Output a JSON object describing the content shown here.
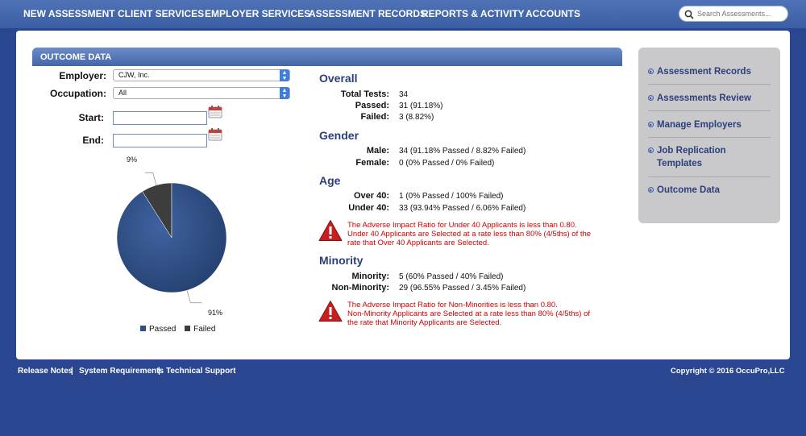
{
  "nav": {
    "items": [
      "NEW ASSESSMENT",
      "CLIENT SERVICES",
      "EMPLOYER SERVICES",
      "ASSESSMENT RECORDS",
      "REPORTS & ACTIVITY",
      "ACCOUNTS"
    ],
    "search_placeholder": "Search Assessments..."
  },
  "section": {
    "title": "OUTCOME DATA"
  },
  "filters": {
    "employer_label": "Employer:",
    "employer_value": "CJW, Inc.",
    "occupation_label": "Occupation:",
    "occupation_value": "All",
    "start_label": "Start:",
    "start_value": "",
    "end_label": "End:",
    "end_value": ""
  },
  "chart_data": {
    "type": "pie",
    "slices": [
      {
        "name": "Passed",
        "value": 91,
        "label": "91%",
        "color": "#2e4e84"
      },
      {
        "name": "Failed",
        "value": 9,
        "label": "9%",
        "color": "#3d3d3d"
      }
    ],
    "legend": [
      "Passed",
      "Failed"
    ],
    "legend_placement": "bottom"
  },
  "overall": {
    "heading": "Overall",
    "rows": [
      {
        "label": "Total Tests:",
        "value": "34"
      },
      {
        "label": "Passed:",
        "value": "31 (91.18%)"
      },
      {
        "label": "Failed:",
        "value": "3 (8.82%)"
      }
    ]
  },
  "gender": {
    "heading": "Gender",
    "rows": [
      {
        "label": "Male:",
        "value": "34 (91.18% Passed / 8.82% Failed)"
      },
      {
        "label": "Female:",
        "value": "0 (0% Passed / 0% Failed)"
      }
    ]
  },
  "age": {
    "heading": "Age",
    "rows": [
      {
        "label": "Over 40:",
        "value": "1 (0% Passed / 100% Failed)"
      },
      {
        "label": "Under 40:",
        "value": "33 (93.94% Passed / 6.06% Failed)"
      }
    ],
    "warning": [
      "The Adverse Impact Ratio for Under 40 Applicants is less than 0.80.",
      "Under 40 Applicants are Selected at a rate less than 80% (4/5ths) of the",
      "rate that Over 40 Applicants are Selected."
    ]
  },
  "minority": {
    "heading": "Minority",
    "rows": [
      {
        "label": "Minority:",
        "value": "5 (60% Passed / 40% Failed)"
      },
      {
        "label": "Non-Minority:",
        "value": "29 (96.55% Passed / 3.45% Failed)"
      }
    ],
    "warning": [
      "The Adverse Impact Ratio for Non-Minorities is less than 0.80.",
      "Non-Minority Applicants are Selected at a rate less than 80% (4/5ths) of",
      "the rate that Minority Applicants are Selected."
    ]
  },
  "sidebar": {
    "items": [
      "Assessment Records",
      "Assessments Review",
      "Manage Employers",
      "Job Replication Templates",
      "Outcome Data"
    ]
  },
  "footer": {
    "links": [
      "Release Notes",
      "System Requirements",
      "Technical Support"
    ],
    "separator": "|",
    "copyright": "Copyright © 2016 OccuPro,LLC"
  }
}
